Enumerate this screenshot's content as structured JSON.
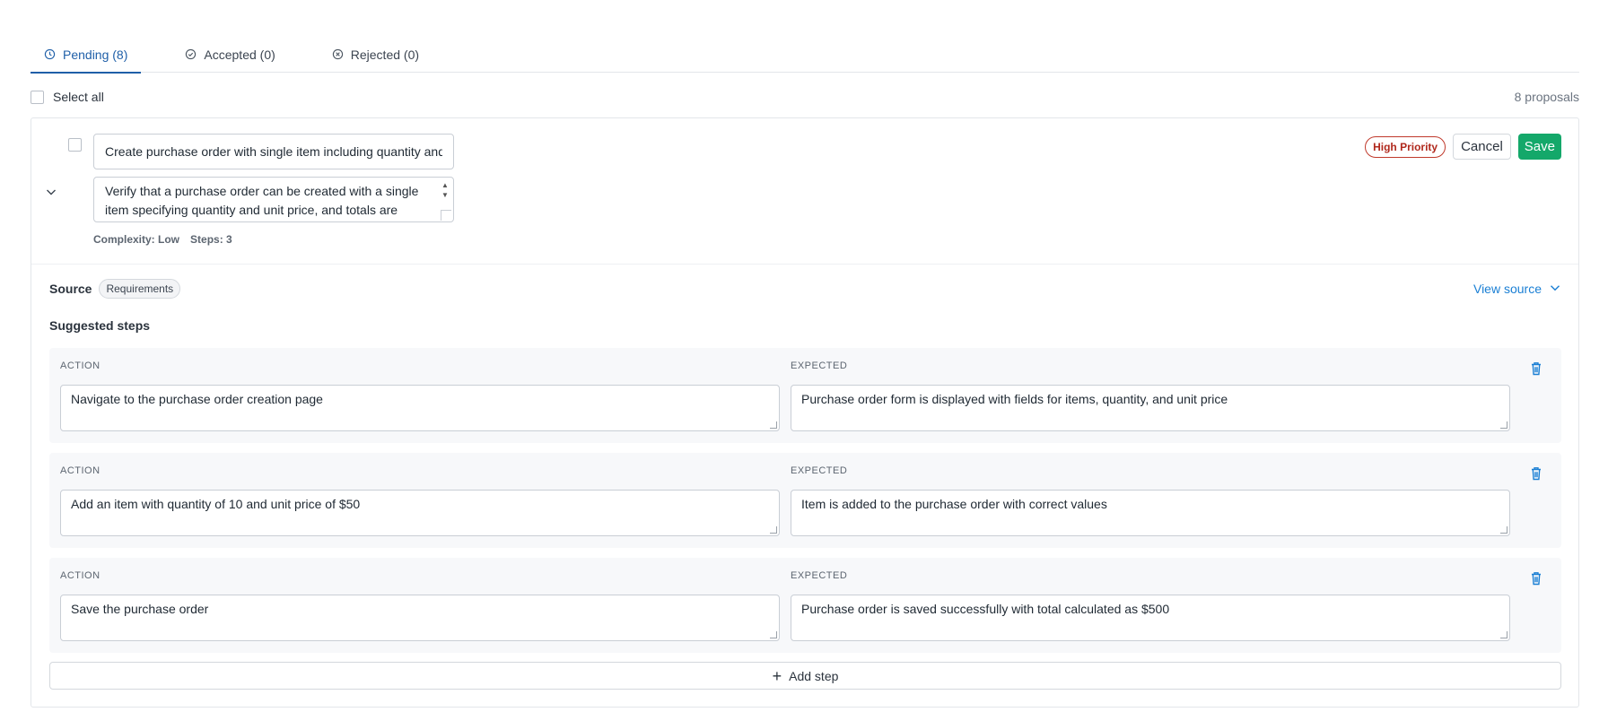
{
  "tabs": [
    {
      "label": "Pending (8)",
      "icon": "clock-icon",
      "active": true
    },
    {
      "label": "Accepted (0)",
      "icon": "check-circle-icon",
      "active": false
    },
    {
      "label": "Rejected (0)",
      "icon": "x-circle-icon",
      "active": false
    }
  ],
  "select_all_label": "Select all",
  "proposal_count": "8 proposals",
  "proposal": {
    "title": "Create purchase order with single item including quantity and unit price",
    "description": "Verify that a purchase order can be created with a single item specifying quantity and unit price, and totals are",
    "complexity": "Complexity: Low",
    "steps_count": "Steps: 3",
    "priority_badge": "High Priority",
    "cancel_label": "Cancel",
    "save_label": "Save",
    "source_label": "Source",
    "source_badge": "Requirements",
    "view_source_label": "View source",
    "steps_title": "Suggested steps",
    "action_header": "ACTION",
    "expected_header": "EXPECTED",
    "steps": [
      {
        "action": "Navigate to the purchase order creation page",
        "expected": "Purchase order form is displayed with fields for items, quantity, and unit price"
      },
      {
        "action": "Add an item with quantity of 10 and unit price of $50",
        "expected": "Item is added to the purchase order with correct values"
      },
      {
        "action": "Save the purchase order",
        "expected": "Purchase order is saved successfully with total calculated as $500"
      }
    ],
    "add_step_label": "Add step"
  },
  "colors": {
    "accent": "#1f5fa8",
    "link": "#1a7fd4",
    "save": "#14a86a",
    "priority": "#c0392b"
  }
}
